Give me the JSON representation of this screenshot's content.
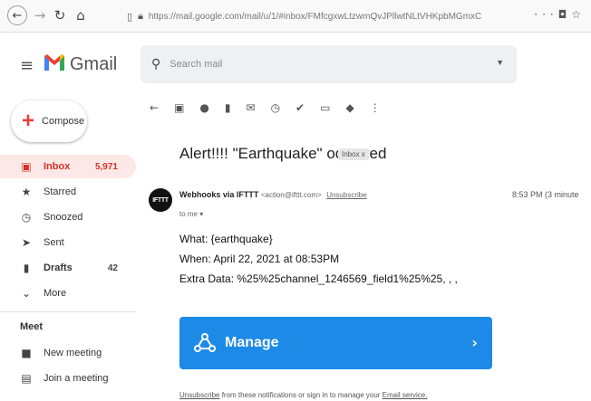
{
  "browser": {
    "url": "https://mail.google.com/mail/u/1/#inbox/FMfcgxwLtzwmQvJPllwtNLtVHKpbMGmxC",
    "menu_icon": "ellipsis-icon"
  },
  "app": {
    "name": "Gmail",
    "search_placeholder": "Search mail"
  },
  "compose": {
    "label": "Compose"
  },
  "sidebar": {
    "items": [
      {
        "label": "Inbox",
        "count": "5,971",
        "icon": "inbox-icon"
      },
      {
        "label": "Starred",
        "count": "",
        "icon": "star-icon"
      },
      {
        "label": "Snoozed",
        "count": "",
        "icon": "clock-icon"
      },
      {
        "label": "Sent",
        "count": "",
        "icon": "send-icon"
      },
      {
        "label": "Drafts",
        "count": "42",
        "icon": "draft-icon"
      },
      {
        "label": "More",
        "count": "",
        "icon": "chevron-down-icon"
      }
    ],
    "meet": {
      "title": "Meet",
      "items": [
        {
          "label": "New meeting",
          "icon": "video-icon"
        },
        {
          "label": "Join a meeting",
          "icon": "keyboard-icon"
        }
      ]
    }
  },
  "message": {
    "subject": "Alert!!!! \"Earthquake\" occurred",
    "label_tag": "Inbox x",
    "sender_name": "Webhooks via IFTTT",
    "sender_email": "<action@ifttt.com>",
    "unsubscribe": "Unsubscribe",
    "to": "to me",
    "time": "8:53 PM (3 minute",
    "avatar_text": "IFTTT",
    "body": {
      "line1": "What: {earthquake}",
      "line2": "When: April 22, 2021 at 08:53PM",
      "line3": "Extra Data: %25%25channel_1246569_field1%25%25, , ,"
    },
    "manage_button": "Manage",
    "footer_link1": "Unsubscribe",
    "footer_text": " from these notifications or sign in to manage your ",
    "footer_link2": "Email service."
  },
  "colors": {
    "accent": "#1d8ae8",
    "inbox_active": "#d93025",
    "compose_plus": "#ea4335"
  }
}
